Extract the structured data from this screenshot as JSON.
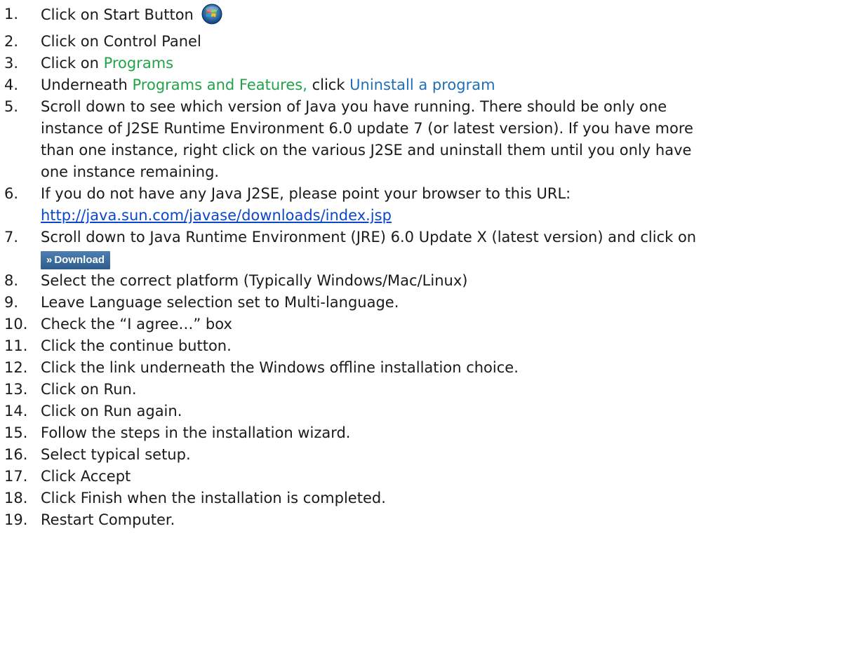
{
  "steps": [
    {
      "num": "1.",
      "text": "Click on Start Button"
    },
    {
      "num": "2.",
      "text": "Click on Control Panel"
    },
    {
      "num": "3.",
      "pre": "Click on ",
      "link": "Programs"
    },
    {
      "num": "4.",
      "pre": "Underneath ",
      "green": "Programs and Features,",
      "mid": " click ",
      "blue": "Uninstall a program"
    },
    {
      "num": "5.",
      "lines": [
        "Scroll down to see which version of Java you have running. There should be only one",
        "instance of J2SE Runtime Environment 6.0 update 7 (or latest version). If you have more",
        "than one instance, right click on the various J2SE and uninstall them until you only have",
        "one instance remaining."
      ]
    },
    {
      "num": "6.",
      "text": "If you do not have any Java J2SE, please point your browser to this URL:",
      "url": "http://java.sun.com/javase/downloads/index.jsp"
    },
    {
      "num": "7.",
      "text": "Scroll down to Java Runtime Environment (JRE) 6.0 Update X (latest version) and click on",
      "button_arrow": "»",
      "button_label": "Download"
    },
    {
      "num": "8.",
      "text": "Select the correct platform (Typically Windows/Mac/Linux)"
    },
    {
      "num": "9.",
      "text": "Leave Language selection set to Multi-language."
    },
    {
      "num": "10.",
      "text": "Check the “I agree…” box"
    },
    {
      "num": "11.",
      "text": "Click the continue button."
    },
    {
      "num": "12.",
      "text": "Click the link underneath the Windows offline installation choice."
    },
    {
      "num": "13.",
      "text": "Click on Run."
    },
    {
      "num": "14.",
      "text": "Click on Run again."
    },
    {
      "num": "15.",
      "text": "Follow the steps in the installation wizard."
    },
    {
      "num": "16.",
      "text": "Select typical setup."
    },
    {
      "num": "17.",
      "text": "Click Accept"
    },
    {
      "num": "18.",
      "text": "Click Finish when the installation is completed."
    },
    {
      "num": "19.",
      "text": "Restart Computer."
    }
  ],
  "colors": {
    "green": "#21a348",
    "blue": "#1f6fb8",
    "link": "#0b47c9",
    "button": "#3a6b9c"
  },
  "icons": {
    "start_button": "windows-start-orb-icon"
  }
}
